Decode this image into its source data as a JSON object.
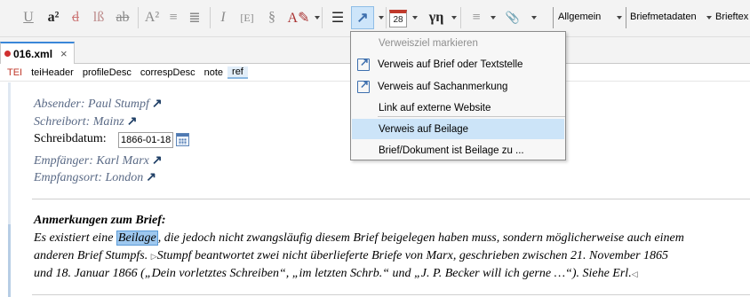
{
  "toolbar": {
    "buttons": [
      {
        "id": "underline",
        "glyph": "U"
      },
      {
        "id": "superscript",
        "glyph": "a²"
      },
      {
        "id": "strikethrough",
        "glyph": "d"
      },
      {
        "id": "add-delete",
        "glyph": "lß"
      },
      {
        "id": "abbreviation",
        "glyph": "ab"
      },
      {
        "id": "footnote",
        "glyph": "A²"
      },
      {
        "id": "heading-a",
        "glyph": "≡"
      },
      {
        "id": "heading-b",
        "glyph": "≣"
      },
      {
        "id": "italic",
        "glyph": "I"
      },
      {
        "id": "bracket",
        "glyph": "[E]"
      },
      {
        "id": "section",
        "glyph": "§"
      },
      {
        "id": "pen",
        "glyph": "A✎"
      },
      {
        "id": "list",
        "glyph": "☰"
      },
      {
        "id": "reference",
        "glyph": "↗"
      },
      {
        "id": "calendar",
        "glyph": "28"
      },
      {
        "id": "greek",
        "glyph": "γη"
      },
      {
        "id": "align",
        "glyph": "≡"
      },
      {
        "id": "attachment",
        "glyph": "📎"
      }
    ],
    "allgemein": "Allgemein",
    "briefmetadaten": "Briefmetadaten",
    "brieftext": "Brieftex"
  },
  "tab": {
    "filename": "016.xml",
    "close": "×"
  },
  "breadcrumb": [
    "TEI",
    "teiHeader",
    "profileDesc",
    "correspDesc",
    "note",
    "ref"
  ],
  "metadata": {
    "absender": "Absender: Paul Stumpf",
    "schreibort": "Schreibort: Mainz",
    "schreibdatum_label": "Schreibdatum:",
    "schreibdatum_value": "1866-01-18",
    "empfaenger": "Empfänger: Karl Marx",
    "empfangsort": "Empfangsort: London",
    "arrow": "↗"
  },
  "notes": {
    "title": "Anmerkungen zum Brief:",
    "line1_pre": "Es existiert eine ",
    "line1_hl": "Beilage",
    "line1_post": ", die jedoch nicht zwangsläufig diesem Brief beigelegen haben muss, sondern möglicherweise auch einem",
    "line2_pre": "anderen Brief Stumpfs. ",
    "marker_open": "▷",
    "line2_post": "Stumpf beantwortet zwei nicht überlieferte Briefe von Marx, geschrieben zwischen 21. November 1865",
    "line3": "und 18. Januar 1866 („Dein vorletztes Schreiben“, „im letzten Schrb.“ und „J. P. Becker will ich gerne …“). Siehe Erl.",
    "marker_close": "◁"
  },
  "menu": {
    "items": [
      {
        "label": "Verweisziel markieren",
        "disabled": true,
        "icon": "none"
      },
      {
        "label": "Verweis auf Brief oder Textstelle",
        "disabled": false,
        "icon": "external-link-icon"
      },
      {
        "label": "Verweis auf Sachanmerkung",
        "disabled": false,
        "icon": "external-link-icon"
      },
      {
        "label": "Link auf externe Website",
        "disabled": false,
        "icon": "none"
      },
      {
        "label": "Verweis auf Beilage",
        "disabled": false,
        "icon": "none",
        "hover": true
      },
      {
        "label": "Brief/Dokument ist Beilage zu ...",
        "disabled": false,
        "icon": "none"
      }
    ]
  },
  "colors": {
    "accent": "#3a87d8",
    "hover": "#cce4f8",
    "highlight": "#9ec8ef",
    "link_arrow": "#1f3f66"
  }
}
